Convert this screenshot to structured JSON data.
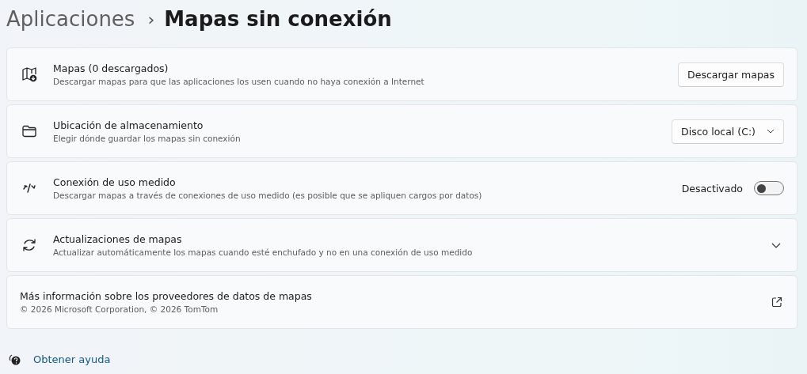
{
  "breadcrumb": {
    "parent": "Aplicaciones",
    "separator": "›",
    "current": "Mapas sin conexión"
  },
  "cards": [
    {
      "kind": "button",
      "title": "Mapas (0 descargados)",
      "description": "Descargar mapas para que las aplicaciones los usen cuando no haya conexión a Internet",
      "button": "Descargar mapas"
    },
    {
      "kind": "dropdown",
      "title": "Ubicación de almacenamiento",
      "description": "Elegir dónde guardar los mapas sin conexión",
      "value": "Disco local (C:)"
    },
    {
      "kind": "toggle",
      "title": "Conexión de uso medido",
      "description": "Descargar mapas a través de conexiones de uso medido (es posible que se apliquen cargos por datos)",
      "state_label": "Desactivado",
      "on": false
    },
    {
      "kind": "expander",
      "title": "Actualizaciones de mapas",
      "description": "Actualizar automáticamente los mapas cuando esté enchufado y no en una conexión de uso medido",
      "expanded": false
    },
    {
      "kind": "link",
      "title": "Más información sobre los proveedores de datos de mapas",
      "description": "© 2026 Microsoft Corporation, © 2026 TomTom"
    }
  ],
  "help_link": "Obtener ayuda"
}
